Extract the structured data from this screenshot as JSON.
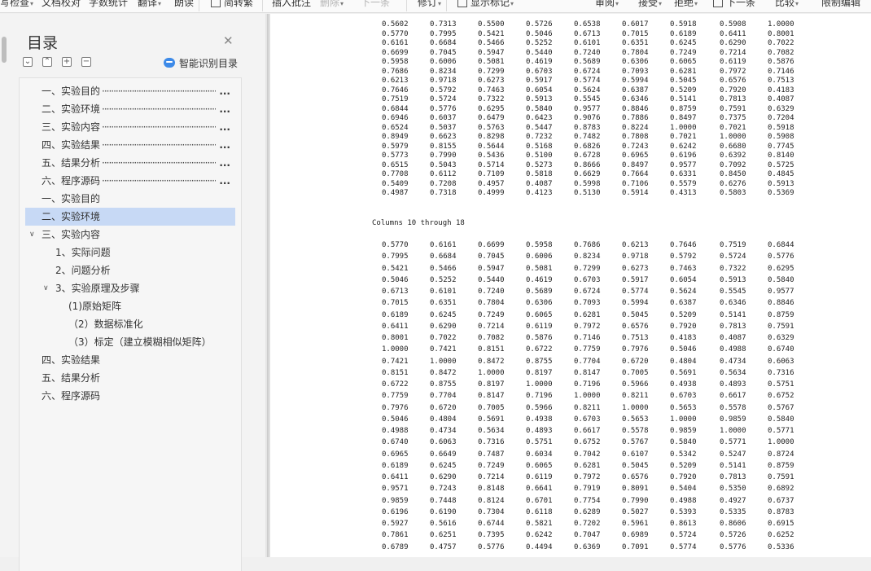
{
  "toolbar": {
    "items": [
      {
        "label": "写检查",
        "arrow": true,
        "disabled": false
      },
      {
        "label": "文档校对",
        "arrow": false,
        "disabled": false
      },
      {
        "label": "字数统计",
        "arrow": false,
        "disabled": false
      },
      {
        "label": "翻译",
        "arrow": true,
        "disabled": false
      },
      {
        "label": "朗读",
        "arrow": false,
        "disabled": false
      },
      {
        "label": "简转繁",
        "arrow": false,
        "disabled": false
      },
      {
        "label": "插入批注",
        "arrow": false,
        "disabled": false
      },
      {
        "label": "删除",
        "arrow": true,
        "disabled": true
      },
      {
        "label": "下一条",
        "arrow": false,
        "disabled": true
      },
      {
        "label": "修订",
        "arrow": true,
        "disabled": false
      },
      {
        "label": "显示标记",
        "arrow": true,
        "disabled": false
      },
      {
        "label": "审阅",
        "arrow": true,
        "disabled": false
      },
      {
        "label": "接受",
        "arrow": true,
        "disabled": false
      },
      {
        "label": "拒绝",
        "arrow": true,
        "disabled": false
      },
      {
        "label": "下一条",
        "arrow": false,
        "disabled": false
      },
      {
        "label": "比较",
        "arrow": true,
        "disabled": false
      },
      {
        "label": "限制编辑",
        "arrow": false,
        "disabled": false
      }
    ]
  },
  "toc": {
    "title": "目录",
    "ai_label": "智能识别目录",
    "items": [
      {
        "text": "一、实验目的",
        "dotted": true,
        "level": 0,
        "selected": false,
        "chevron": ""
      },
      {
        "text": "二、实验环境",
        "dotted": true,
        "level": 0,
        "selected": false,
        "chevron": ""
      },
      {
        "text": "三、实验内容",
        "dotted": true,
        "level": 0,
        "selected": false,
        "chevron": ""
      },
      {
        "text": "四、实验结果",
        "dotted": true,
        "level": 0,
        "selected": false,
        "chevron": ""
      },
      {
        "text": "五、结果分析",
        "dotted": true,
        "level": 0,
        "selected": false,
        "chevron": ""
      },
      {
        "text": "六、程序源码",
        "dotted": true,
        "level": 0,
        "selected": false,
        "chevron": ""
      },
      {
        "text": "一、实验目的",
        "dotted": false,
        "level": 0,
        "selected": false,
        "chevron": ""
      },
      {
        "text": "二、实验环境",
        "dotted": false,
        "level": 0,
        "selected": true,
        "chevron": ""
      },
      {
        "text": "三、实验内容",
        "dotted": false,
        "level": 0,
        "selected": false,
        "chevron": "∨"
      },
      {
        "text": "1、实际问题",
        "dotted": false,
        "level": 1,
        "selected": false,
        "chevron": ""
      },
      {
        "text": "2、问题分析",
        "dotted": false,
        "level": 1,
        "selected": false,
        "chevron": ""
      },
      {
        "text": "3、实验原理及步骤",
        "dotted": false,
        "level": 1,
        "selected": false,
        "chevron": "∨"
      },
      {
        "text": "(1)原始矩阵",
        "dotted": false,
        "level": 2,
        "selected": false,
        "chevron": ""
      },
      {
        "text": "（2）数据标准化",
        "dotted": false,
        "level": 2,
        "selected": false,
        "chevron": ""
      },
      {
        "text": "（3）标定（建立模糊相似矩阵）",
        "dotted": false,
        "level": 2,
        "selected": false,
        "chevron": ""
      },
      {
        "text": "四、实验结果",
        "dotted": false,
        "level": 0,
        "selected": false,
        "chevron": ""
      },
      {
        "text": "五、结果分析",
        "dotted": false,
        "level": 0,
        "selected": false,
        "chevron": ""
      },
      {
        "text": "六、程序源码",
        "dotted": false,
        "level": 0,
        "selected": false,
        "chevron": ""
      }
    ]
  },
  "doc": {
    "top_rows": [
      [
        "0.5602",
        "0.7313",
        "0.5500",
        "0.5726",
        "0.6538",
        "0.6017",
        "0.5918",
        "0.5908",
        "1.0000"
      ],
      [
        "0.5770",
        "0.7995",
        "0.5421",
        "0.5046",
        "0.6713",
        "0.7015",
        "0.6189",
        "0.6411",
        "0.8001"
      ],
      [
        "0.6161",
        "0.6684",
        "0.5466",
        "0.5252",
        "0.6101",
        "0.6351",
        "0.6245",
        "0.6290",
        "0.7022"
      ],
      [
        "0.6699",
        "0.7045",
        "0.5947",
        "0.5440",
        "0.7240",
        "0.7804",
        "0.7249",
        "0.7214",
        "0.7082"
      ],
      [
        "0.5958",
        "0.6006",
        "0.5081",
        "0.4619",
        "0.5689",
        "0.6306",
        "0.6065",
        "0.6119",
        "0.5876"
      ],
      [
        "0.7686",
        "0.8234",
        "0.7299",
        "0.6703",
        "0.6724",
        "0.7093",
        "0.6281",
        "0.7972",
        "0.7146"
      ],
      [
        "0.6213",
        "0.9718",
        "0.6273",
        "0.5917",
        "0.5774",
        "0.5994",
        "0.5045",
        "0.6576",
        "0.7513"
      ],
      [
        "0.7646",
        "0.5792",
        "0.7463",
        "0.6054",
        "0.5624",
        "0.6387",
        "0.5209",
        "0.7920",
        "0.4183"
      ],
      [
        "0.7519",
        "0.5724",
        "0.7322",
        "0.5913",
        "0.5545",
        "0.6346",
        "0.5141",
        "0.7813",
        "0.4087"
      ],
      [
        "0.6844",
        "0.5776",
        "0.6295",
        "0.5840",
        "0.9577",
        "0.8846",
        "0.8759",
        "0.7591",
        "0.6329"
      ],
      [
        "0.6946",
        "0.6037",
        "0.6479",
        "0.6423",
        "0.9076",
        "0.7886",
        "0.8497",
        "0.7375",
        "0.7204"
      ],
      [
        "0.6524",
        "0.5037",
        "0.5763",
        "0.5447",
        "0.8783",
        "0.8224",
        "1.0000",
        "0.7021",
        "0.5918"
      ],
      [
        "0.8949",
        "0.6623",
        "0.8298",
        "0.7232",
        "0.7482",
        "0.7808",
        "0.7021",
        "1.0000",
        "0.5908"
      ],
      [
        "0.5979",
        "0.8155",
        "0.5644",
        "0.5168",
        "0.6826",
        "0.7243",
        "0.6242",
        "0.6680",
        "0.7745"
      ],
      [
        "0.5773",
        "0.7990",
        "0.5436",
        "0.5100",
        "0.6728",
        "0.6965",
        "0.6196",
        "0.6392",
        "0.8140"
      ],
      [
        "0.6515",
        "0.5043",
        "0.5714",
        "0.5273",
        "0.8666",
        "0.8497",
        "0.9577",
        "0.7092",
        "0.5725"
      ],
      [
        "0.7708",
        "0.6112",
        "0.7109",
        "0.5818",
        "0.6629",
        "0.7664",
        "0.6331",
        "0.8450",
        "0.4845"
      ],
      [
        "0.5409",
        "0.7208",
        "0.4957",
        "0.4087",
        "0.5998",
        "0.7106",
        "0.5579",
        "0.6276",
        "0.5913"
      ],
      [
        "0.4987",
        "0.7318",
        "0.4999",
        "0.4123",
        "0.5130",
        "0.5914",
        "0.4313",
        "0.5803",
        "0.5369"
      ]
    ],
    "section_label": "Columns 10 through 18",
    "bottom_rows": [
      [
        "0.5770",
        "0.6161",
        "0.6699",
        "0.5958",
        "0.7686",
        "0.6213",
        "0.7646",
        "0.7519",
        "0.6844"
      ],
      [
        "0.7995",
        "0.6684",
        "0.7045",
        "0.6006",
        "0.8234",
        "0.9718",
        "0.5792",
        "0.5724",
        "0.5776"
      ],
      [
        "0.5421",
        "0.5466",
        "0.5947",
        "0.5081",
        "0.7299",
        "0.6273",
        "0.7463",
        "0.7322",
        "0.6295"
      ],
      [
        "0.5046",
        "0.5252",
        "0.5440",
        "0.4619",
        "0.6703",
        "0.5917",
        "0.6054",
        "0.5913",
        "0.5840"
      ],
      [
        "0.6713",
        "0.6101",
        "0.7240",
        "0.5689",
        "0.6724",
        "0.5774",
        "0.5624",
        "0.5545",
        "0.9577"
      ],
      [
        "0.7015",
        "0.6351",
        "0.7804",
        "0.6306",
        "0.7093",
        "0.5994",
        "0.6387",
        "0.6346",
        "0.8846"
      ],
      [
        "0.6189",
        "0.6245",
        "0.7249",
        "0.6065",
        "0.6281",
        "0.5045",
        "0.5209",
        "0.5141",
        "0.8759"
      ],
      [
        "0.6411",
        "0.6290",
        "0.7214",
        "0.6119",
        "0.7972",
        "0.6576",
        "0.7920",
        "0.7813",
        "0.7591"
      ],
      [
        "0.8001",
        "0.7022",
        "0.7082",
        "0.5876",
        "0.7146",
        "0.7513",
        "0.4183",
        "0.4087",
        "0.6329"
      ],
      [
        "1.0000",
        "0.7421",
        "0.8151",
        "0.6722",
        "0.7759",
        "0.7976",
        "0.5046",
        "0.4988",
        "0.6740"
      ],
      [
        "0.7421",
        "1.0000",
        "0.8472",
        "0.8755",
        "0.7704",
        "0.6720",
        "0.4804",
        "0.4734",
        "0.6063"
      ],
      [
        "0.8151",
        "0.8472",
        "1.0000",
        "0.8197",
        "0.8147",
        "0.7005",
        "0.5691",
        "0.5634",
        "0.7316"
      ],
      [
        "0.6722",
        "0.8755",
        "0.8197",
        "1.0000",
        "0.7196",
        "0.5966",
        "0.4938",
        "0.4893",
        "0.5751"
      ],
      [
        "0.7759",
        "0.7704",
        "0.8147",
        "0.7196",
        "1.0000",
        "0.8211",
        "0.6703",
        "0.6617",
        "0.6752"
      ],
      [
        "0.7976",
        "0.6720",
        "0.7005",
        "0.5966",
        "0.8211",
        "1.0000",
        "0.5653",
        "0.5578",
        "0.5767"
      ],
      [
        "0.5046",
        "0.4804",
        "0.5691",
        "0.4938",
        "0.6703",
        "0.5653",
        "1.0000",
        "0.9859",
        "0.5840"
      ],
      [
        "0.4988",
        "0.4734",
        "0.5634",
        "0.4893",
        "0.6617",
        "0.5578",
        "0.9859",
        "1.0000",
        "0.5771"
      ],
      [
        "0.6740",
        "0.6063",
        "0.7316",
        "0.5751",
        "0.6752",
        "0.5767",
        "0.5840",
        "0.5771",
        "1.0000"
      ],
      [
        "0.6965",
        "0.6649",
        "0.7487",
        "0.6034",
        "0.7042",
        "0.6107",
        "0.5342",
        "0.5247",
        "0.8724"
      ],
      [
        "0.6189",
        "0.6245",
        "0.7249",
        "0.6065",
        "0.6281",
        "0.5045",
        "0.5209",
        "0.5141",
        "0.8759"
      ],
      [
        "0.6411",
        "0.6290",
        "0.7214",
        "0.6119",
        "0.7972",
        "0.6576",
        "0.7920",
        "0.7813",
        "0.7591"
      ],
      [
        "0.9571",
        "0.7243",
        "0.8148",
        "0.6641",
        "0.7919",
        "0.8091",
        "0.5404",
        "0.5350",
        "0.6892"
      ],
      [
        "0.9859",
        "0.7448",
        "0.8124",
        "0.6701",
        "0.7754",
        "0.7990",
        "0.4988",
        "0.4927",
        "0.6737"
      ],
      [
        "0.6196",
        "0.6190",
        "0.7304",
        "0.6118",
        "0.6289",
        "0.5027",
        "0.5393",
        "0.5335",
        "0.8783"
      ],
      [
        "0.5927",
        "0.5616",
        "0.6744",
        "0.5821",
        "0.7202",
        "0.5961",
        "0.8613",
        "0.8606",
        "0.6915"
      ],
      [
        "0.7861",
        "0.6251",
        "0.7395",
        "0.6242",
        "0.7047",
        "0.6989",
        "0.5724",
        "0.5726",
        "0.6252"
      ],
      [
        "0.6789",
        "0.4757",
        "0.5776",
        "0.4494",
        "0.6369",
        "0.7091",
        "0.5774",
        "0.5776",
        "0.5336"
      ]
    ]
  }
}
